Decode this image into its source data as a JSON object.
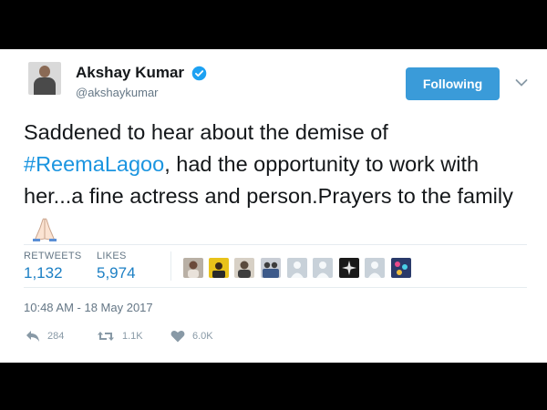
{
  "user": {
    "name": "Akshay Kumar",
    "handle": "@akshaykumar",
    "follow_label": "Following"
  },
  "tweet": {
    "text_before": "Saddened to hear about the demise of",
    "hashtag": "#ReemaLagoo",
    "text_after": ", had the opportunity to work with her...a fine actress and person.Prayers to the family"
  },
  "stats": {
    "retweets_label": "RETWEETS",
    "retweets_value": "1,132",
    "likes_label": "LIKES",
    "likes_value": "5,974"
  },
  "likers": [
    {
      "icon": "avatar-woman",
      "color": "#b9b0a5"
    },
    {
      "icon": "avatar-yellow",
      "color": "#e8c21a"
    },
    {
      "icon": "avatar-man-dark",
      "color": "#5a4a3c"
    },
    {
      "icon": "avatar-group",
      "color": "#3d5a8a"
    },
    {
      "icon": "default-egg",
      "color": "#c8d1d9"
    },
    {
      "icon": "default-egg",
      "color": "#c8d1d9"
    },
    {
      "icon": "avatar-dark-star",
      "color": "#1a1a1a"
    },
    {
      "icon": "default-egg",
      "color": "#c8d1d9"
    },
    {
      "icon": "avatar-colorful",
      "color": "#2a3a6a"
    }
  ],
  "timestamp": "10:48 AM - 18 May 2017",
  "actions": {
    "reply_count": "284",
    "retweet_count": "1.1K",
    "like_count": "6.0K"
  },
  "colors": {
    "link": "#1b95e0",
    "button": "#3a9bd9",
    "secondary": "#657786"
  }
}
